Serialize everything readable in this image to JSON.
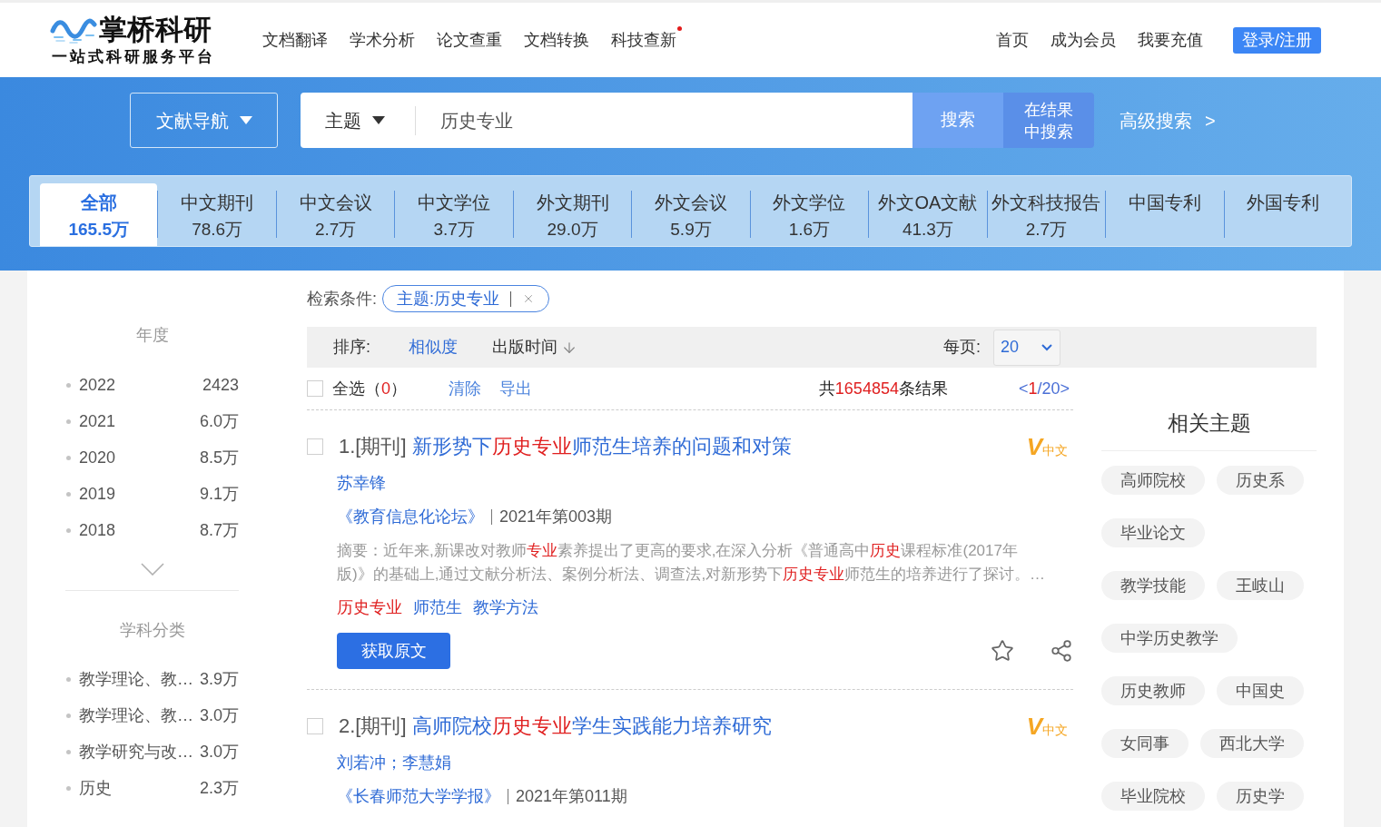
{
  "header": {
    "logo": {
      "name": "掌桥科研",
      "slogan": "一站式科研服务平台"
    },
    "nav": [
      {
        "label": "文档翻译",
        "dot": false
      },
      {
        "label": "学术分析",
        "dot": false
      },
      {
        "label": "论文查重",
        "dot": false
      },
      {
        "label": "文档转换",
        "dot": false
      },
      {
        "label": "科技查新",
        "dot": true
      }
    ],
    "links": [
      "首页",
      "成为会员",
      "我要充值"
    ],
    "login": "登录/注册"
  },
  "search": {
    "nav_button": "文献导航",
    "field_type": "主题",
    "query": "历史专业",
    "search_button": "搜索",
    "refine_button": "在结果中搜索",
    "advanced": "高级搜索",
    "advanced_arrow": ">"
  },
  "tabs": [
    {
      "label": "全部",
      "count": "165.5万",
      "selected": true
    },
    {
      "label": "中文期刊",
      "count": "78.6万",
      "selected": false
    },
    {
      "label": "中文会议",
      "count": "2.7万",
      "selected": false
    },
    {
      "label": "中文学位",
      "count": "3.7万",
      "selected": false
    },
    {
      "label": "外文期刊",
      "count": "29.0万",
      "selected": false
    },
    {
      "label": "外文会议",
      "count": "5.9万",
      "selected": false
    },
    {
      "label": "外文学位",
      "count": "1.6万",
      "selected": false
    },
    {
      "label": "外文OA文献",
      "count": "41.3万",
      "selected": false
    },
    {
      "label": "外文科技报告",
      "count": "2.7万",
      "selected": false
    },
    {
      "label": "中国专利",
      "selected": false
    },
    {
      "label": "外国专利",
      "selected": false
    }
  ],
  "facets": [
    {
      "title": "年度",
      "show_more": true,
      "items": [
        {
          "label": "2022",
          "count": "2423"
        },
        {
          "label": "2021",
          "count": "6.0万"
        },
        {
          "label": "2020",
          "count": "8.5万"
        },
        {
          "label": "2019",
          "count": "9.1万"
        },
        {
          "label": "2018",
          "count": "8.7万"
        }
      ]
    },
    {
      "title": "学科分类",
      "show_more": false,
      "items": [
        {
          "label": "教学理论、教…",
          "count": "3.9万"
        },
        {
          "label": "教学理论、教…",
          "count": "3.0万"
        },
        {
          "label": "教学研究与改…",
          "count": "3.0万"
        },
        {
          "label": "历史",
          "count": "2.3万"
        }
      ]
    }
  ],
  "filters": {
    "label": "检索条件:",
    "chips": [
      "主题:历史专业"
    ]
  },
  "sort": {
    "label": "排序:",
    "options": [
      {
        "label": "相似度",
        "selected": true,
        "sort_arrow": false
      },
      {
        "label": "出版时间",
        "selected": false,
        "sort_arrow": true
      }
    ],
    "per_page_label": "每页:",
    "per_page": "20"
  },
  "selection": {
    "checked": false,
    "select_all": [
      {
        "text": "全选（",
        "highlight": false
      },
      {
        "text": "0",
        "highlight": true
      },
      {
        "text": "）",
        "highlight": false
      }
    ],
    "actions": [
      "清除",
      "导出"
    ],
    "total": [
      {
        "text": "共",
        "highlight": false
      },
      {
        "text": "1654854",
        "highlight": true
      },
      {
        "text": "条结果",
        "highlight": false
      }
    ],
    "pager": [
      {
        "text": "<",
        "highlight": false
      },
      {
        "text": "1",
        "highlight": true
      },
      {
        "text": "/20>",
        "highlight": false
      }
    ]
  },
  "results": [
    {
      "checked": false,
      "label": "1.[期刊]",
      "title": [
        {
          "text": "新形势下",
          "highlight": false
        },
        {
          "text": "历史专业",
          "highlight": true
        },
        {
          "text": "师范生培养的问题和对策",
          "highlight": false
        }
      ],
      "badge": {
        "mark": "V",
        "label": "中文"
      },
      "authors": "苏幸锋",
      "source": "《教育信息化论坛》",
      "issue": "2021年第003期",
      "abstract": [
        {
          "text": "摘要：近年来,新课改对教师",
          "highlight": false
        },
        {
          "text": "专业",
          "highlight": true
        },
        {
          "text": "素养提出了更高的要求,在深入分析《普通高中",
          "highlight": false
        },
        {
          "text": "历史",
          "highlight": true
        },
        {
          "text": "课程标准(2017年版)》的基础上,通过文献分析法、案例分析法、调查法,对新形势下",
          "highlight": false
        },
        {
          "text": "历史专业",
          "highlight": true
        },
        {
          "text": "师范生的培养进行了探讨。…",
          "highlight": false
        }
      ],
      "keywords": [
        {
          "text": "历史专业",
          "highlight": true
        },
        {
          "text": "师范生",
          "highlight": false
        },
        {
          "text": "教学方法",
          "highlight": false
        }
      ],
      "action": "获取原文"
    },
    {
      "checked": false,
      "label": "2.[期刊]",
      "title": [
        {
          "text": "高师院校",
          "highlight": false
        },
        {
          "text": "历史专业",
          "highlight": true
        },
        {
          "text": "学生实践能力培养研究",
          "highlight": false
        }
      ],
      "badge": {
        "mark": "V",
        "label": "中文"
      },
      "authors": "刘若冲；李慧娟",
      "source": "《长春师范大学学报》",
      "issue": "2021年第011期"
    }
  ],
  "related": {
    "title": "相关主题",
    "rows": [
      [
        "高师院校",
        "历史系"
      ],
      [
        "毕业论文"
      ],
      [
        "教学技能",
        "王岐山"
      ],
      [
        "中学历史教学"
      ],
      [
        "历史教师",
        "中国史"
      ],
      [
        "女同事",
        "西北大学"
      ],
      [
        "毕业院校",
        "历史学"
      ]
    ]
  }
}
